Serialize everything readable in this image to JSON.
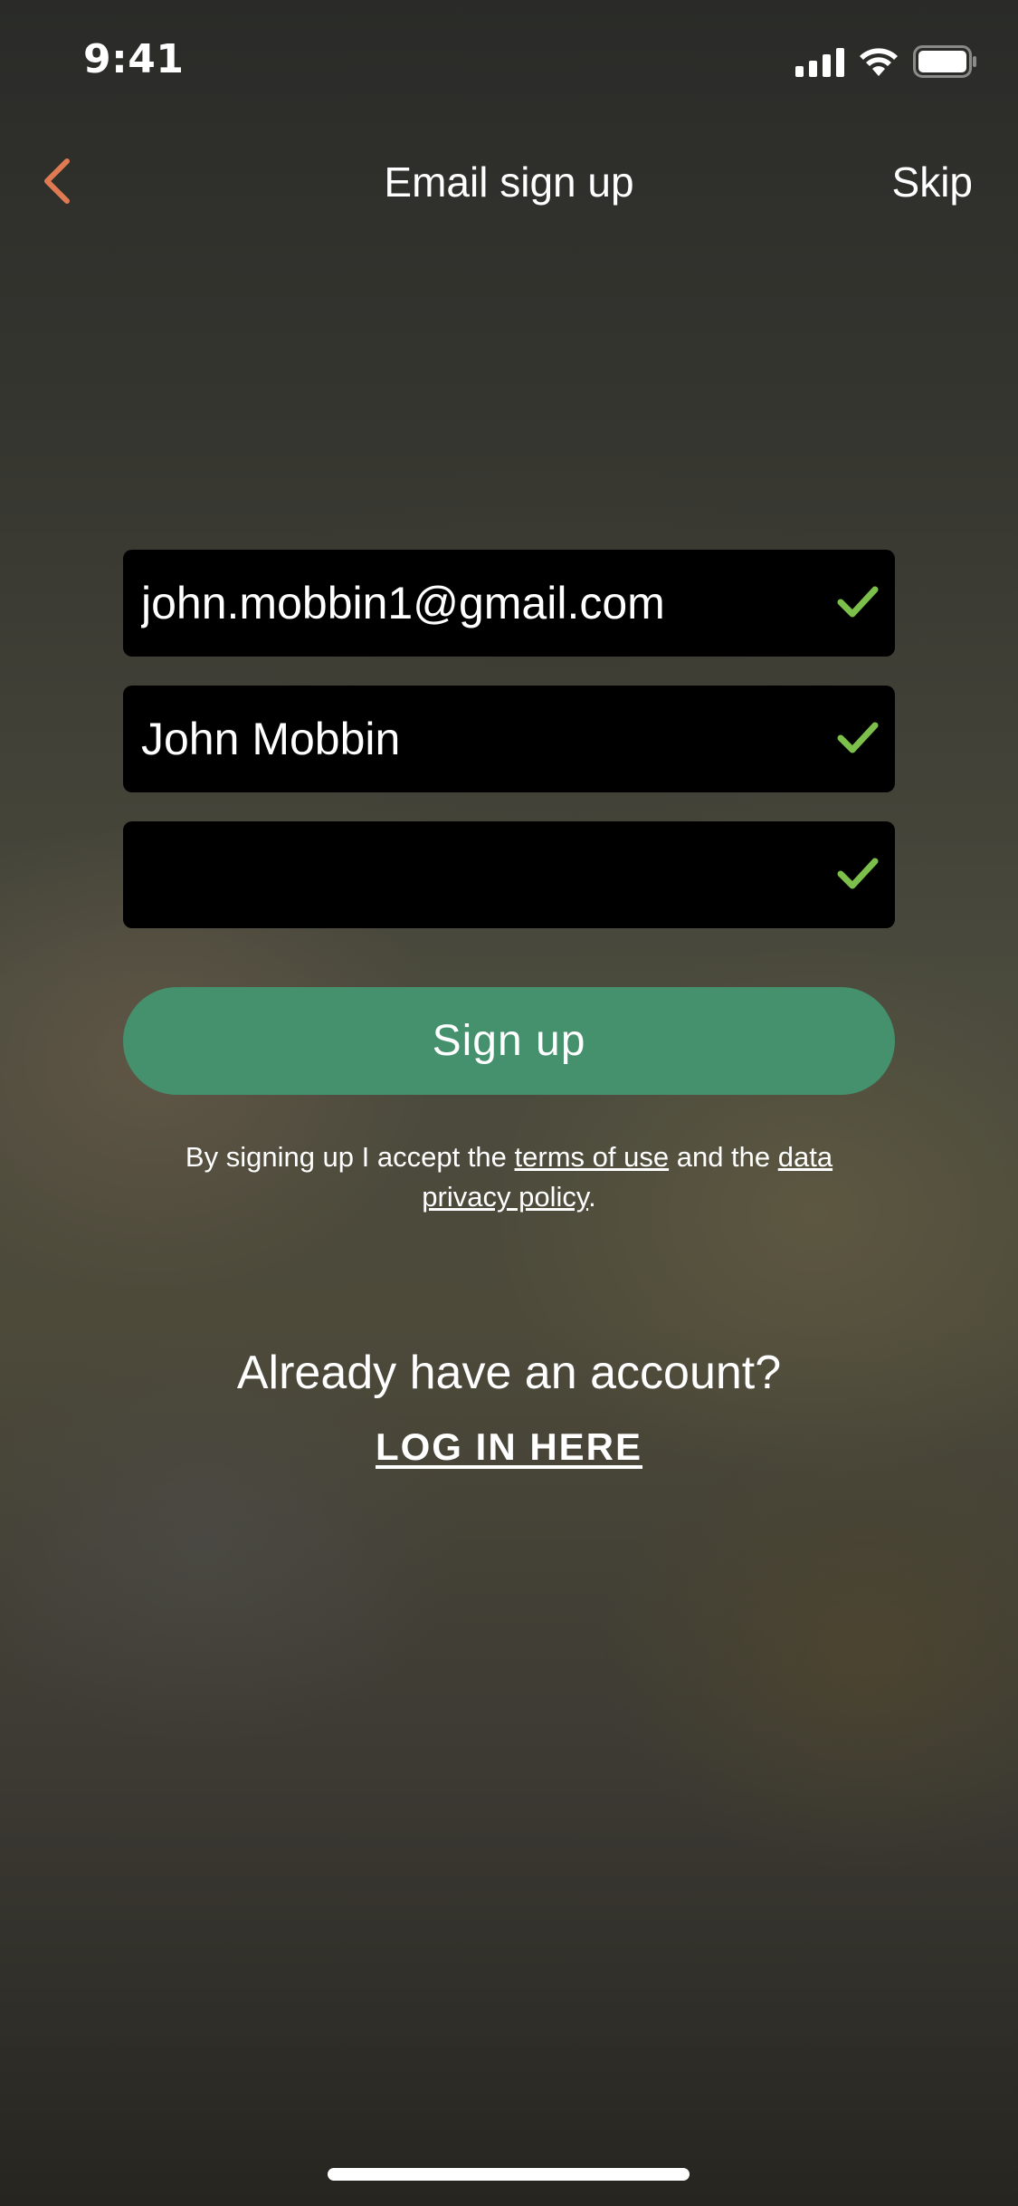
{
  "status_bar": {
    "time": "9:41"
  },
  "header": {
    "title": "Email sign up",
    "skip_label": "Skip",
    "back_icon": "chevron-left-icon",
    "accent_color": "#e07a52"
  },
  "form": {
    "email_value": "john.mobbin1@gmail.com",
    "name_value": "John Mobbin",
    "password_value": "",
    "valid_icon": "check-icon",
    "valid_color": "#7cc04b",
    "field_bg": "#000000"
  },
  "signup_button": {
    "label": "Sign up",
    "color": "#45906d"
  },
  "terms": {
    "prefix": "By signing up I accept the ",
    "terms_link": "terms of use",
    "middle": " and the ",
    "privacy_link": "data privacy policy",
    "suffix": "."
  },
  "login": {
    "prompt": "Already have an account?",
    "link_label": "LOG IN HERE"
  }
}
